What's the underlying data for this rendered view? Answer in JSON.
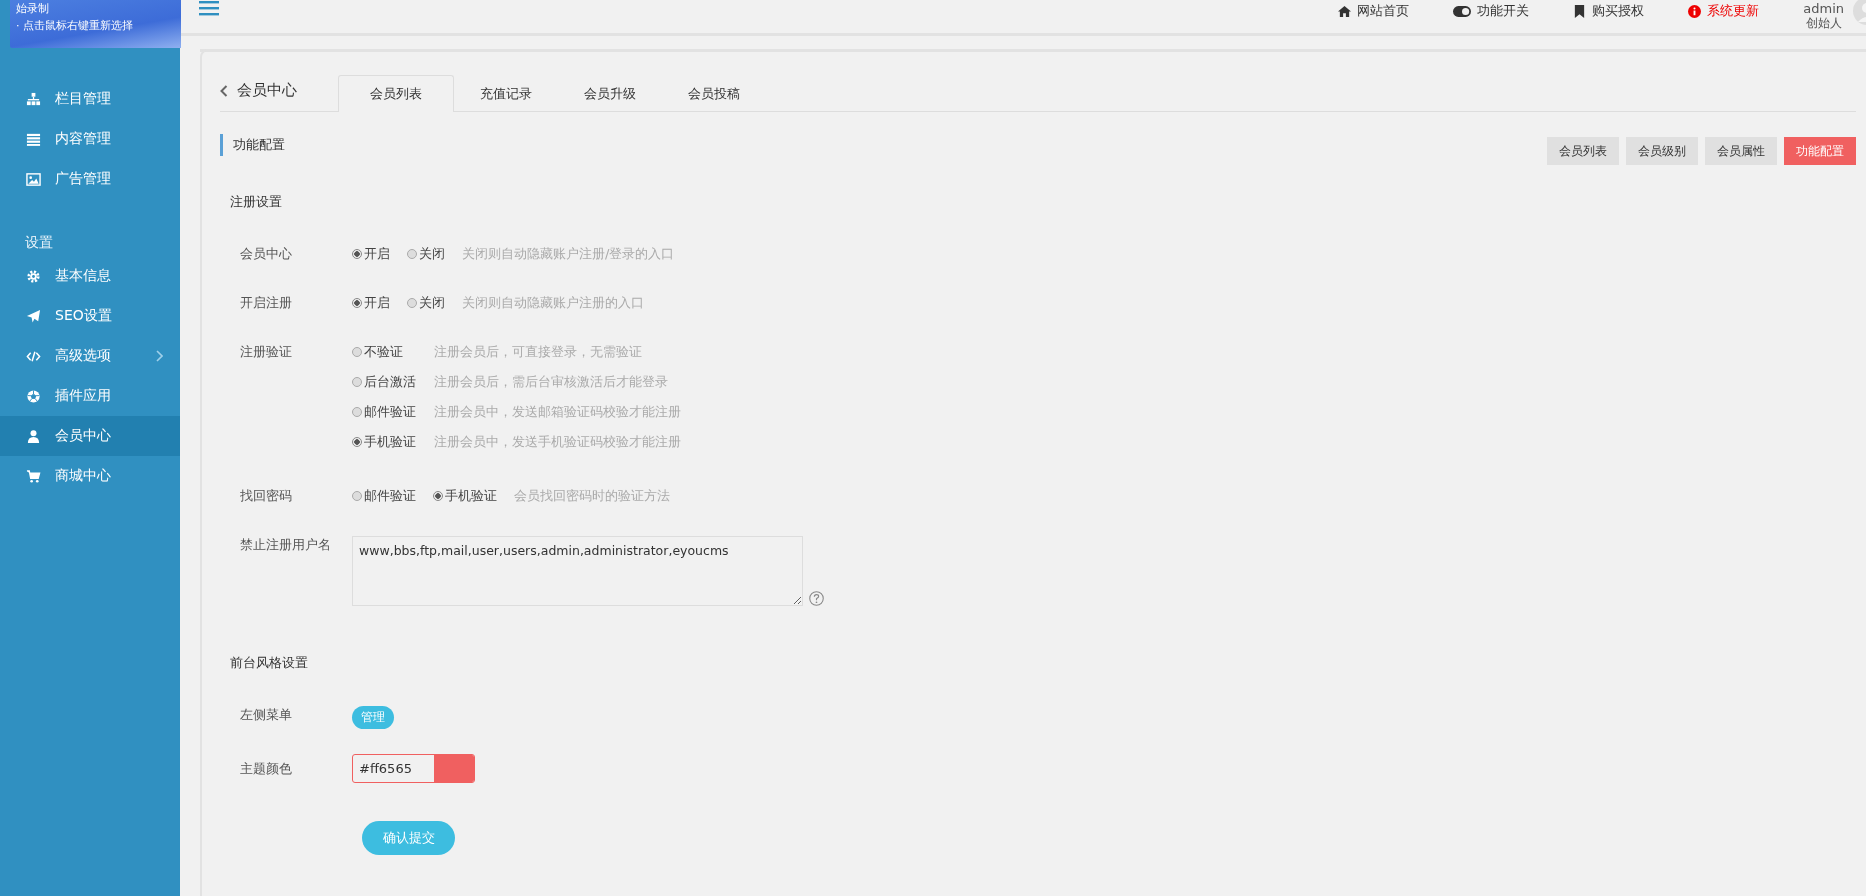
{
  "recording_tip": {
    "lines": [
      "始录制",
      "· 点击鼠标右键重新选择"
    ]
  },
  "top_nav": {
    "links": [
      {
        "label": "网站首页",
        "alert": false
      },
      {
        "label": "功能开关",
        "alert": false
      },
      {
        "label": "购买授权",
        "alert": false
      },
      {
        "label": "系统更新",
        "alert": true
      }
    ],
    "user": {
      "name": "admin",
      "role": "创始人"
    }
  },
  "sidebar": {
    "items": [
      {
        "kind": "item",
        "label": "栏目管理",
        "selected": false,
        "expandable": false
      },
      {
        "kind": "item",
        "label": "内容管理",
        "selected": false,
        "expandable": false
      },
      {
        "kind": "item",
        "label": "广告管理",
        "selected": false,
        "expandable": false
      },
      {
        "kind": "heading",
        "label": "设置"
      },
      {
        "kind": "item",
        "label": "基本信息",
        "selected": false,
        "expandable": false
      },
      {
        "kind": "item",
        "label": "SEO设置",
        "selected": false,
        "expandable": false
      },
      {
        "kind": "item",
        "label": "高级选项",
        "selected": false,
        "expandable": true
      },
      {
        "kind": "item",
        "label": "插件应用",
        "selected": false,
        "expandable": false
      },
      {
        "kind": "item",
        "label": "会员中心",
        "selected": true,
        "expandable": false
      },
      {
        "kind": "item",
        "label": "商城中心",
        "selected": false,
        "expandable": false
      }
    ]
  },
  "breadcrumb": {
    "back": "会员中心"
  },
  "tabs": [
    {
      "label": "会员列表",
      "selected": true
    },
    {
      "label": "充值记录",
      "selected": false
    },
    {
      "label": "会员升级",
      "selected": false
    },
    {
      "label": "会员投稿",
      "selected": false
    }
  ],
  "section": {
    "title": "功能配置",
    "buttons": [
      {
        "label": "会员列表",
        "selected": false
      },
      {
        "label": "会员级别",
        "selected": false
      },
      {
        "label": "会员属性",
        "selected": false
      },
      {
        "label": "功能配置",
        "selected": true
      }
    ]
  },
  "form": {
    "groups": [
      {
        "title": "注册设置",
        "fields": [
          {
            "kind": "radio",
            "label": "会员中心",
            "options": [
              {
                "label": "开启",
                "selected": true
              },
              {
                "label": "关闭",
                "selected": false
              }
            ],
            "hint": "关闭则自动隐藏账户注册/登录的入口"
          },
          {
            "kind": "radio",
            "label": "开启注册",
            "options": [
              {
                "label": "开启",
                "selected": true
              },
              {
                "label": "关闭",
                "selected": false
              }
            ],
            "hint": "关闭则自动隐藏账户注册的入口"
          },
          {
            "kind": "radio_list",
            "label": "注册验证",
            "options": [
              {
                "label": "不验证",
                "hint": "注册会员后，可直接登录，无需验证",
                "selected": false
              },
              {
                "label": "后台激活",
                "hint": "注册会员后，需后台审核激活后才能登录",
                "selected": false
              },
              {
                "label": "邮件验证",
                "hint": "注册会员中，发送邮箱验证码校验才能注册",
                "selected": false
              },
              {
                "label": "手机验证",
                "hint": "注册会员中，发送手机验证码校验才能注册",
                "selected": true
              }
            ]
          },
          {
            "kind": "radio",
            "label": "找回密码",
            "options": [
              {
                "label": "邮件验证",
                "selected": false
              },
              {
                "label": "手机验证",
                "selected": true
              }
            ],
            "hint": "会员找回密码时的验证方法"
          },
          {
            "kind": "textarea",
            "label": "禁止注册用户名",
            "value": "www,bbs,ftp,mail,user,users,admin,administrator,eyoucms"
          }
        ]
      },
      {
        "title": "前台风格设置",
        "fields": [
          {
            "kind": "badge",
            "label": "左侧菜单",
            "value": "管理"
          },
          {
            "kind": "color",
            "label": "主题颜色",
            "value": "#ff6565",
            "color": "#f06060"
          }
        ]
      }
    ],
    "submit": "确认提交"
  }
}
